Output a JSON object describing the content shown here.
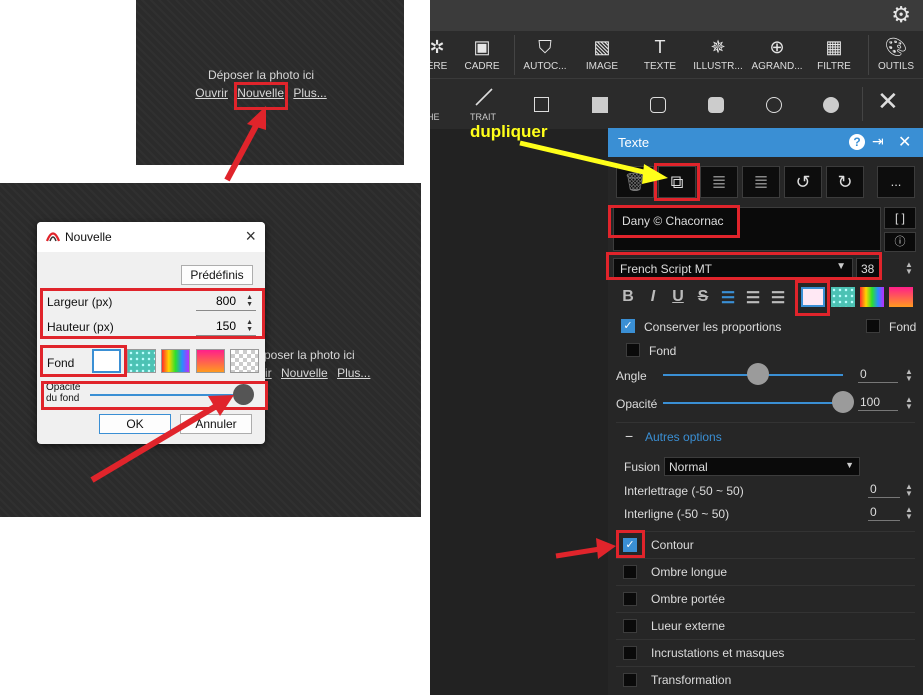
{
  "top_drop": {
    "text": "Déposer la photo ici",
    "links": [
      "Ouvrir",
      "Nouvelle",
      "Plus..."
    ]
  },
  "mid_drop": {
    "text": "poser la photo ici",
    "links": [
      "ir",
      "Nouvelle",
      "Plus..."
    ]
  },
  "dialog": {
    "title": "Nouvelle",
    "close": "×",
    "presets_button": "Prédéfinis",
    "width_label": "Largeur (px)",
    "width_value": "800",
    "height_label": "Hauteur (px)",
    "height_value": "150",
    "fond_label": "Fond",
    "opacity_label_line1": "Opacité",
    "opacity_label_line2": "du fond",
    "ok_button": "OK",
    "cancel_button": "Annuler"
  },
  "annotation": {
    "label": "dupliquer",
    "arrow_color": "#e0242b",
    "label_color": "#ffff1a"
  },
  "toolbar": {
    "items": [
      {
        "label": "ÈRE",
        "icon": "gear-partial-icon"
      },
      {
        "label": "CADRE",
        "icon": "frame-icon"
      },
      {
        "label": "AUTOC...",
        "icon": "sticker-icon"
      },
      {
        "label": "IMAGE",
        "icon": "image-icon"
      },
      {
        "label": "TEXTE",
        "icon": "text-icon"
      },
      {
        "label": "ILLUSTR...",
        "icon": "illustration-icon"
      },
      {
        "label": "AGRAND...",
        "icon": "magnify-icon"
      },
      {
        "label": "FILTRE",
        "icon": "filter-icon"
      },
      {
        "label": "OUTILS",
        "icon": "palette-icon"
      }
    ],
    "shape_row": {
      "left_label": "HE",
      "trait_label": "TRAIT"
    }
  },
  "panel": {
    "title": "Texte",
    "help": "?",
    "text_value": "Dany © Chacornac",
    "font": "French Script MT",
    "font_size": "38",
    "keep_proportions": "Conserver les proportions",
    "fond_right": "Fond",
    "fond": "Fond",
    "angle_label": "Angle",
    "angle_value": "0",
    "angle_level": 0.5,
    "opacity_label": "Opacité",
    "opacity_value": "100",
    "opacity_level": 1.0,
    "more_options": "Autres options",
    "fusion_label": "Fusion",
    "fusion_value": "Normal",
    "spacing_label": "Interlettrage (-50 ~ 50)",
    "spacing_value": "0",
    "line_label": "Interligne (-50 ~ 50)",
    "line_value": "0",
    "options": [
      {
        "label": "Contour",
        "checked": true
      },
      {
        "label": "Ombre longue",
        "checked": false
      },
      {
        "label": "Ombre portée",
        "checked": false
      },
      {
        "label": "Lueur externe",
        "checked": false
      },
      {
        "label": "Incrustations et masques",
        "checked": false
      },
      {
        "label": "Transformation",
        "checked": false
      }
    ],
    "more_button": "..."
  }
}
